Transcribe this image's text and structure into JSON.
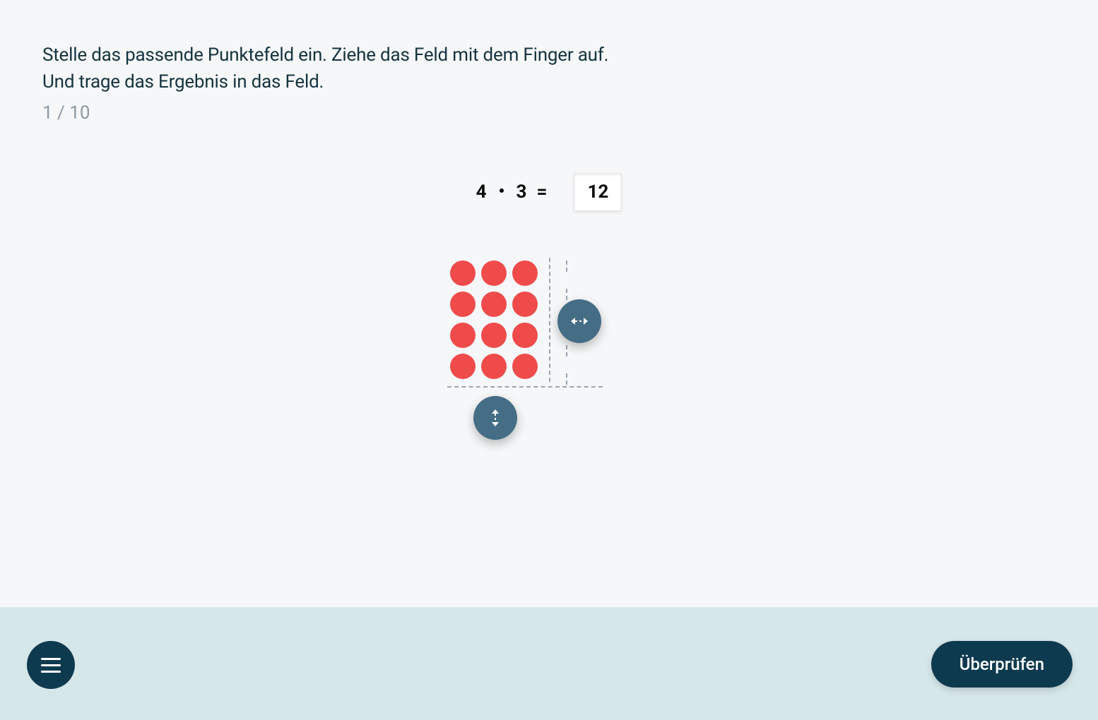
{
  "instructions": {
    "line1": "Stelle das passende Punktefeld ein. Ziehe das Feld mit dem Finger auf.",
    "line2": "Und trage das Ergebnis in das Feld."
  },
  "progress": {
    "text": "1 / 10",
    "current": 1,
    "total": 10
  },
  "equation": {
    "operand1": "4",
    "operand2": "3",
    "equals": "=",
    "answer": "12"
  },
  "dot_field": {
    "rows": 4,
    "cols": 3,
    "dot_color": "#ef4b4b"
  },
  "colors": {
    "handle": "#456d86",
    "footer": "#d6e7ea",
    "primary_dark": "#0e3a4f"
  },
  "buttons": {
    "check": "Überprüfen"
  }
}
